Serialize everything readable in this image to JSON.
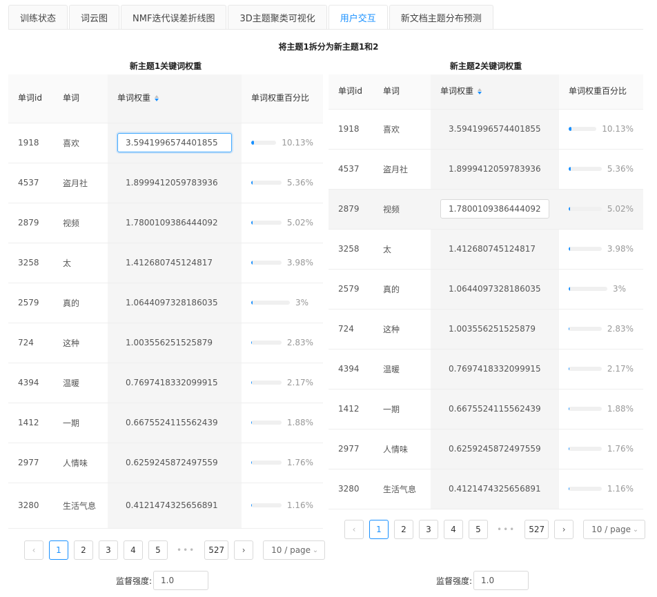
{
  "tabs": [
    {
      "label": "训练状态",
      "active": false
    },
    {
      "label": "词云图",
      "active": false
    },
    {
      "label": "NMF迭代误差折线图",
      "active": false
    },
    {
      "label": "3D主题聚类可视化",
      "active": false
    },
    {
      "label": "用户交互",
      "active": true
    },
    {
      "label": "新文档主题分布预测",
      "active": false
    }
  ],
  "main_title": "将主题1拆分为新主题1和2",
  "columns": {
    "id": "单词id",
    "word": "单词",
    "weight": "单词权重",
    "percent": "单词权重百分比"
  },
  "topic1": {
    "title": "新主题1关键词权重",
    "rows": [
      {
        "id": "1918",
        "word": "喜欢",
        "weight": "3.5941996574401855",
        "percent": "10.13%",
        "pct": 10.13
      },
      {
        "id": "4537",
        "word": "盗月社",
        "weight": "1.8999412059783936",
        "percent": "5.36%",
        "pct": 5.36
      },
      {
        "id": "2879",
        "word": "视频",
        "weight": "1.7800109386444092",
        "percent": "5.02%",
        "pct": 5.02
      },
      {
        "id": "3258",
        "word": "太",
        "weight": "1.412680745124817",
        "percent": "3.98%",
        "pct": 3.98
      },
      {
        "id": "2579",
        "word": "真的",
        "weight": "1.0644097328186035",
        "percent": "3%",
        "pct": 3
      },
      {
        "id": "724",
        "word": "这种",
        "weight": "1.003556251525879",
        "percent": "2.83%",
        "pct": 2.83
      },
      {
        "id": "4394",
        "word": "温暖",
        "weight": "0.7697418332099915",
        "percent": "2.17%",
        "pct": 2.17
      },
      {
        "id": "1412",
        "word": "一期",
        "weight": "0.6675524115562439",
        "percent": "1.88%",
        "pct": 1.88
      },
      {
        "id": "2977",
        "word": "人情味",
        "weight": "0.6259245872497559",
        "percent": "1.76%",
        "pct": 1.76
      },
      {
        "id": "3280",
        "word": "生活气息",
        "weight": "0.4121474325656891",
        "percent": "1.16%",
        "pct": 1.16
      }
    ],
    "strength_label": "监督强度:",
    "strength_value": "1.0"
  },
  "topic2": {
    "title": "新主题2关键词权重",
    "rows": [
      {
        "id": "1918",
        "word": "喜欢",
        "weight": "3.5941996574401855",
        "percent": "10.13%",
        "pct": 10.13
      },
      {
        "id": "4537",
        "word": "盗月社",
        "weight": "1.8999412059783936",
        "percent": "5.36%",
        "pct": 5.36
      },
      {
        "id": "2879",
        "word": "视频",
        "weight": "1.7800109386444092",
        "percent": "5.02%",
        "pct": 5.02
      },
      {
        "id": "3258",
        "word": "太",
        "weight": "1.412680745124817",
        "percent": "3.98%",
        "pct": 3.98
      },
      {
        "id": "2579",
        "word": "真的",
        "weight": "1.0644097328186035",
        "percent": "3%",
        "pct": 3
      },
      {
        "id": "724",
        "word": "这种",
        "weight": "1.003556251525879",
        "percent": "2.83%",
        "pct": 2.83
      },
      {
        "id": "4394",
        "word": "温暖",
        "weight": "0.7697418332099915",
        "percent": "2.17%",
        "pct": 2.17
      },
      {
        "id": "1412",
        "word": "一期",
        "weight": "0.6675524115562439",
        "percent": "1.88%",
        "pct": 1.88
      },
      {
        "id": "2977",
        "word": "人情味",
        "weight": "0.6259245872497559",
        "percent": "1.76%",
        "pct": 1.76
      },
      {
        "id": "3280",
        "word": "生活气息",
        "weight": "0.4121474325656891",
        "percent": "1.16%",
        "pct": 1.16
      }
    ],
    "strength_label": "监督强度:",
    "strength_value": "1.0"
  },
  "pagination": {
    "pages": [
      "1",
      "2",
      "3",
      "4",
      "5"
    ],
    "current": "1",
    "ellipsis": "•••",
    "last": "527",
    "page_size": "10 / page",
    "prev_icon": "‹",
    "next_icon": "›"
  },
  "colors": {
    "accent": "#1890ff"
  }
}
